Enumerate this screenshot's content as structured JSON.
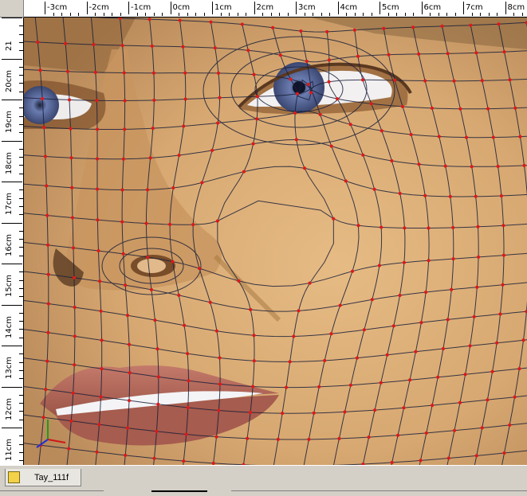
{
  "window": {
    "document_tab": "Tay_111f",
    "tab_icon": "scene-document-icon"
  },
  "rulers": {
    "horizontal_labels": [
      "-3cm",
      "-2cm",
      "-1cm",
      "0cm",
      "1cm",
      "2cm",
      "3cm",
      "4cm",
      "5cm",
      "6cm",
      "7cm",
      "8cm"
    ],
    "vertical_labels": [
      "21",
      "20cm",
      "19cm",
      "18cm",
      "17cm",
      "16cm",
      "15cm",
      "14cm",
      "13cm",
      "12cm",
      "11cm"
    ]
  },
  "viewport": {
    "content": "3D face mesh wireframe",
    "skin_color": "#d9b07a",
    "wire_color": "#1a1f3a",
    "vertex_color": "#e01818",
    "lip_color": "#b8685a",
    "iris_color": "#5a6a9a",
    "axis_colors": {
      "x": "#d01818",
      "y": "#18a018",
      "z": "#2030d0"
    }
  },
  "colors": {
    "chrome": "#d4d0c8",
    "ruler": "#ffffff"
  }
}
